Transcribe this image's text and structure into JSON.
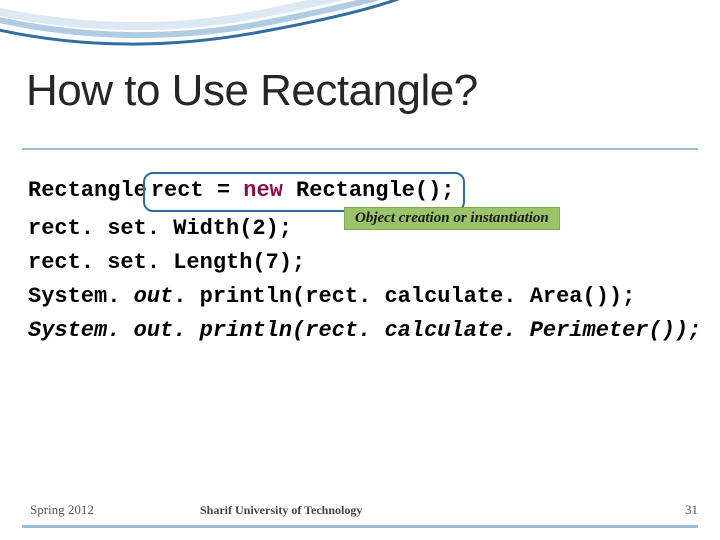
{
  "title": "How to Use Rectangle?",
  "code": {
    "l1a": "Rectangle",
    "l1b_var": " rect = ",
    "l1b_kw": "new",
    "l1b_rest": " Rectangle();",
    "l2": "rect. set. Width(2);",
    "l3": "rect. set. Length(7);",
    "l4a": "System. ",
    "l4b": "out",
    "l4c": ". println(rect. calculate. Area());",
    "l5a": "System. ",
    "l5b": "out",
    "l5c": ". println(rect. calculate. Perimeter());"
  },
  "note": "Object creation or instantiation",
  "footer": {
    "left": "Spring 2012",
    "mid": "Sharif University of Technology",
    "right": "31"
  }
}
